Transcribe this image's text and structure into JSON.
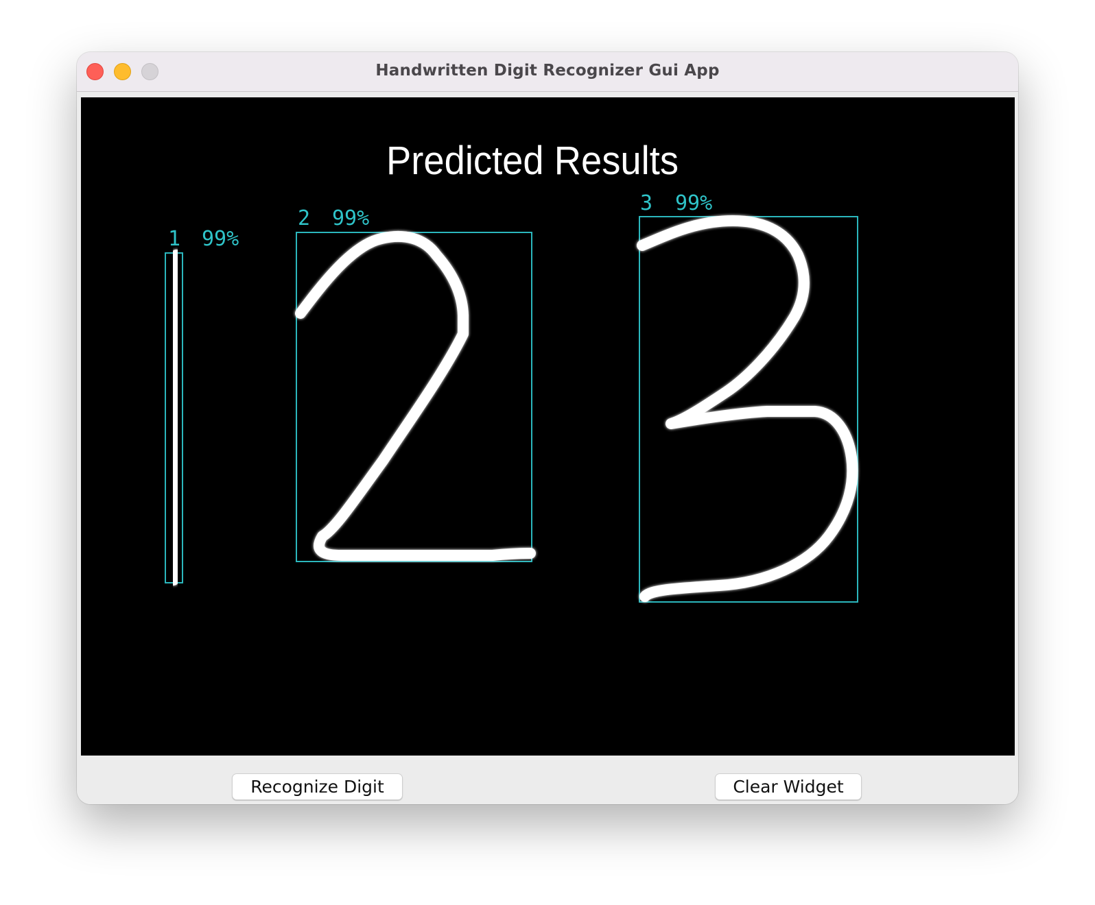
{
  "window": {
    "title": "Handwritten Digit Recognizer Gui App"
  },
  "canvas": {
    "heading": "Predicted Results",
    "predictions": [
      {
        "digit": "1",
        "confidence": "99%"
      },
      {
        "digit": "2",
        "confidence": "99%"
      },
      {
        "digit": "3",
        "confidence": "99%"
      }
    ],
    "colors": {
      "background": "#000000",
      "box": "#2bb7bd",
      "label": "#2fc4c9",
      "stroke": "#ffffff",
      "glow": "#7fe9ee"
    }
  },
  "buttons": {
    "recognize_label": "Recognize Digit",
    "clear_label": "Clear Widget"
  }
}
